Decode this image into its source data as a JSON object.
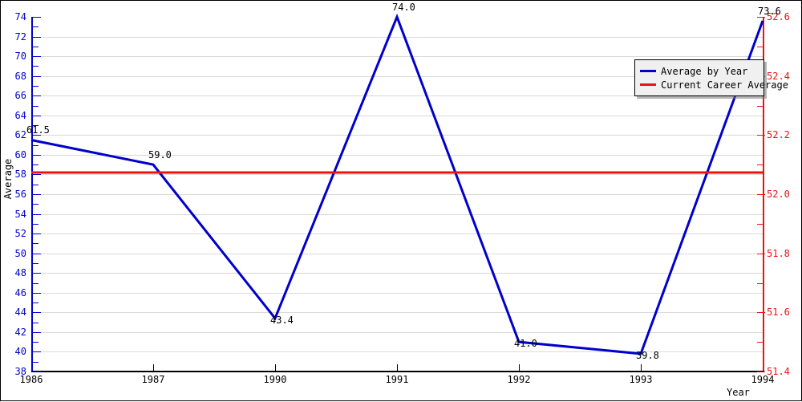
{
  "chart_data": {
    "type": "line",
    "title": "",
    "xlabel": "Year",
    "ylabel": "Average",
    "grid": true,
    "legend_position": "top-right",
    "categories": [
      "1986",
      "1987",
      "1990",
      "1991",
      "1992",
      "1993",
      "1994"
    ],
    "x": [
      1986,
      1987,
      1990,
      1991,
      1992,
      1993,
      1994
    ],
    "xlim": [
      1986,
      1994
    ],
    "ylim": [
      38,
      74
    ],
    "y_ticks": [
      38,
      40,
      42,
      44,
      46,
      48,
      50,
      52,
      54,
      56,
      58,
      60,
      62,
      64,
      66,
      68,
      70,
      72,
      74
    ],
    "y2lim": [
      51.4,
      52.6
    ],
    "y2_ticks": [
      51.4,
      51.6,
      51.8,
      52.0,
      52.2,
      52.4,
      52.6
    ],
    "series": [
      {
        "name": "Average by Year",
        "color": "#0000cc",
        "axis": "left",
        "values": [
          61.5,
          59.0,
          43.4,
          74.0,
          41.0,
          39.8,
          73.6
        ],
        "point_labels": [
          "61.5",
          "59.0",
          "43.4",
          "74.0",
          "41.0",
          "39.8",
          "73.6"
        ]
      },
      {
        "name": "Current Career Average",
        "color": "#ee1111",
        "axis": "left",
        "constant": 58.2,
        "values": [
          58.2,
          58.2,
          58.2,
          58.2,
          58.2,
          58.2,
          58.2
        ],
        "point_labels": []
      }
    ]
  },
  "axes": {
    "left": {
      "title": "Average",
      "color": "#0000cc",
      "tick_labels": [
        "74",
        "72",
        "70",
        "68",
        "66",
        "64",
        "62",
        "60",
        "58",
        "56",
        "54",
        "52",
        "50",
        "48",
        "46",
        "44",
        "42",
        "40",
        "38"
      ]
    },
    "right": {
      "color": "#ee1111",
      "tick_labels": [
        "52.6",
        "52.4",
        "52.2",
        "52.0",
        "51.8",
        "51.6",
        "51.4"
      ]
    },
    "bottom": {
      "title": "Year",
      "color": "#000000",
      "tick_labels": [
        "1986",
        "1987",
        "1990",
        "1991",
        "1992",
        "1993",
        "1994"
      ]
    }
  },
  "legend": {
    "items": [
      {
        "label": "Average by Year",
        "color": "#0000cc"
      },
      {
        "label": "Current Career Average",
        "color": "#ee1111"
      }
    ]
  }
}
